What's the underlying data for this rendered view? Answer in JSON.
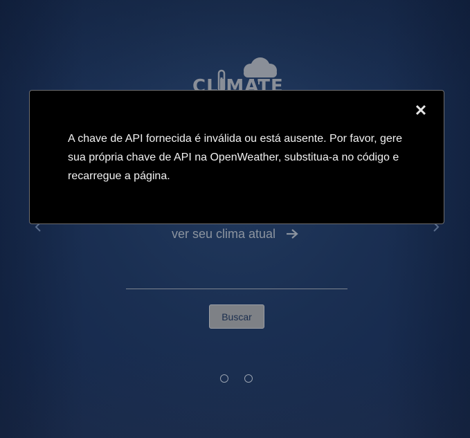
{
  "logo": {
    "text": "CLIMATE"
  },
  "carousel": {
    "slide_link_text": "ver seu clima atual",
    "dots_count": 2
  },
  "search": {
    "placeholder": "",
    "button_label": "Buscar"
  },
  "modal": {
    "message": "A chave de API fornecida é inválida ou está ausente. Por favor, gere sua própria chave de API na OpenWeather, substitua-a no código e recarregue a página.",
    "close_symbol": "✕"
  },
  "icons": {
    "logo": "cloud-rain-thermometer-icon",
    "prev": "chevron-left-icon",
    "next": "chevron-right-icon",
    "link_arrow": "arrow-right-icon",
    "close": "close-icon"
  }
}
